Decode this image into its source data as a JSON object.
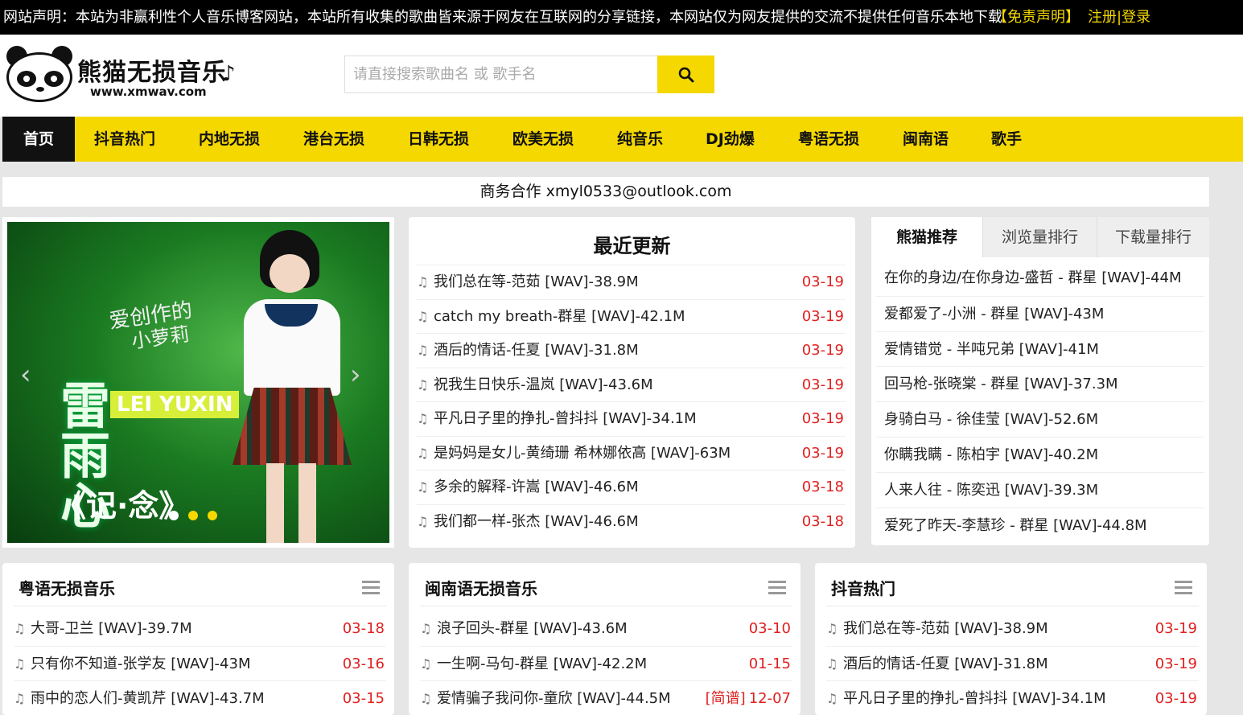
{
  "topbar": {
    "notice": "网站声明：本站为非赢利性个人音乐博客网站，本站所有收集的歌曲皆来源于网友在互联网的分享链接，本网站仅为网友提供的交流不提供任何音乐本地下载",
    "disclaimer": "【免责声明】",
    "auth": "注册|登录"
  },
  "logo": {
    "title": "熊猫无损音乐",
    "url": "www.xmwav.com"
  },
  "search": {
    "placeholder": "请直接搜索歌曲名 或 歌手名",
    "icon": "search-icon"
  },
  "nav": {
    "items": [
      "首页",
      "抖音热门",
      "内地无损",
      "港台无损",
      "日韩无损",
      "欧美无损",
      "纯音乐",
      "DJ劲爆",
      "粤语无损",
      "闽南语",
      "歌手"
    ],
    "active_index": 0
  },
  "biz": "商务合作 xmyl0533@outlook.com",
  "slider": {
    "caption_top": "爱创作的",
    "caption_bottom": "小萝莉",
    "artist_cn": "雷雨心",
    "artist_en": "LEI YUXIN",
    "album": "《记·念》",
    "active_dot": 0,
    "dot_count": 3
  },
  "recent": {
    "title": "最近更新",
    "items": [
      {
        "text": "我们总在等-范茹  [WAV]-38.9M",
        "date": "03-19"
      },
      {
        "text": "catch my breath-群星  [WAV]-42.1M",
        "date": "03-19"
      },
      {
        "text": "酒后的情话-任夏  [WAV]-31.8M",
        "date": "03-19"
      },
      {
        "text": "祝我生日快乐-温岚  [WAV]-43.6M",
        "date": "03-19"
      },
      {
        "text": "平凡日子里的挣扎-曾抖抖   [WAV]-34.1M",
        "date": "03-19"
      },
      {
        "text": "是妈妈是女儿-黄绮珊 希林娜依高 [WAV]-63M",
        "date": "03-19"
      },
      {
        "text": "多余的解释-许嵩  [WAV]-46.6M",
        "date": "03-18"
      },
      {
        "text": "我们都一样-张杰  [WAV]-46.6M",
        "date": "03-18"
      }
    ]
  },
  "rank": {
    "tabs": [
      "熊猫推荐",
      "浏览量排行",
      "下载量排行"
    ],
    "active_tab": 0,
    "items": [
      "在你的身边/在你身边-盛哲 - 群星  [WAV]-44M",
      "爱都爱了-小洲 - 群星  [WAV]-43M",
      "爱情错觉 - 半吨兄弟  [WAV]-41M",
      "回马枪-张晓棠 - 群星  [WAV]-37.3M",
      "身骑白马 - 徐佳莹  [WAV]-52.6M",
      "你瞒我瞒 - 陈柏宇  [WAV]-40.2M",
      "人来人往 - 陈奕迅  [WAV]-39.3M",
      "爱死了昨天-李慧珍 - 群星  [WAV]-44.8M"
    ]
  },
  "boxes": [
    {
      "title": "粤语无损音乐",
      "items": [
        {
          "text": "大哥-卫兰  [WAV]-39.7M",
          "tag": "",
          "date": "03-18"
        },
        {
          "text": "只有你不知道-张学友  [WAV]-43M",
          "tag": "",
          "date": "03-16"
        },
        {
          "text": "雨中的恋人们-黄凯芹  [WAV]-43.7M",
          "tag": "",
          "date": "03-15"
        }
      ]
    },
    {
      "title": "闽南语无损音乐",
      "items": [
        {
          "text": "浪子回头-群星  [WAV]-43.6M",
          "tag": "",
          "date": "03-10"
        },
        {
          "text": "一生啊-马句-群星  [WAV]-42.2M",
          "tag": "",
          "date": "01-15"
        },
        {
          "text": "爱情骗子我问你-童欣  [WAV]-44.5M",
          "tag": "[简谱]",
          "date": "12-07"
        }
      ]
    },
    {
      "title": "抖音热门",
      "items": [
        {
          "text": "我们总在等-范茹  [WAV]-38.9M",
          "tag": "",
          "date": "03-19"
        },
        {
          "text": "酒后的情话-任夏  [WAV]-31.8M",
          "tag": "",
          "date": "03-19"
        },
        {
          "text": "平凡日子里的挣扎-曾抖抖  [WAV]-34.1M",
          "tag": "",
          "date": "03-19"
        }
      ]
    }
  ],
  "colors": {
    "accent": "#f5d800",
    "date": "#e02020",
    "topbar": "#000000"
  }
}
